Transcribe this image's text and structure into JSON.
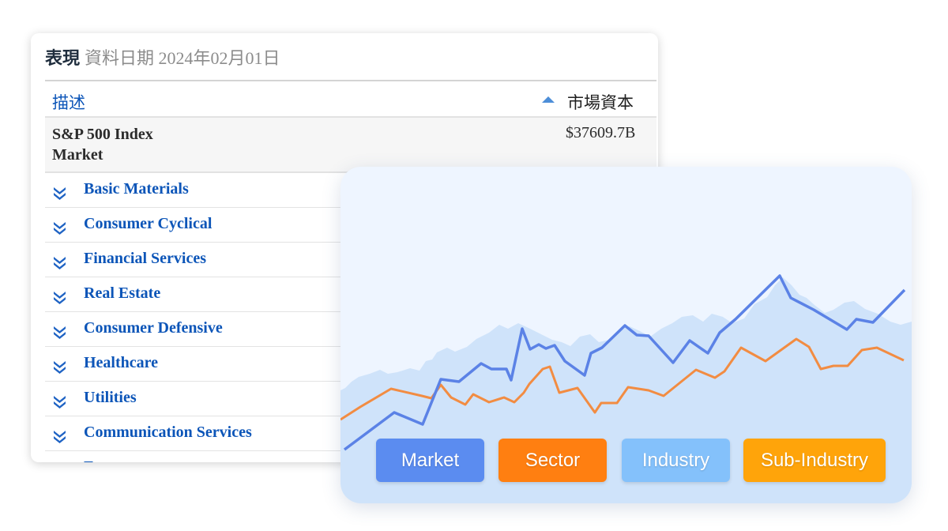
{
  "header": {
    "title": "表現",
    "date": "資料日期 2024年02月01日"
  },
  "table": {
    "col_description": "描述",
    "col_market_cap": "市場資本",
    "market_row": {
      "name_line1": "S&P 500 Index",
      "name_line2": "Market",
      "market_cap": "$37609.7B"
    },
    "sectors": [
      {
        "label": "Basic Materials"
      },
      {
        "label": "Consumer Cyclical"
      },
      {
        "label": "Financial Services"
      },
      {
        "label": "Real Estate"
      },
      {
        "label": "Consumer Defensive"
      },
      {
        "label": "Healthcare"
      },
      {
        "label": "Utilities"
      },
      {
        "label": "Communication Services"
      },
      {
        "label": "E"
      }
    ]
  },
  "legend": {
    "market": {
      "label": "Market",
      "color": "#5b8cf0"
    },
    "sector": {
      "label": "Sector",
      "color": "#ff7f11"
    },
    "industry": {
      "label": "Industry",
      "color": "#84c1fb"
    },
    "sub_industry": {
      "label": "Sub-Industry",
      "color": "#ffa40a"
    }
  },
  "colors": {
    "link_blue": "#0c55b8",
    "market_line": "#5b82e6",
    "sector_line": "#f28c42",
    "industry_area": "#cfe3fa"
  },
  "icons": {
    "sort": "sort-up-icon",
    "expand": "double-chevron-down-icon"
  }
}
